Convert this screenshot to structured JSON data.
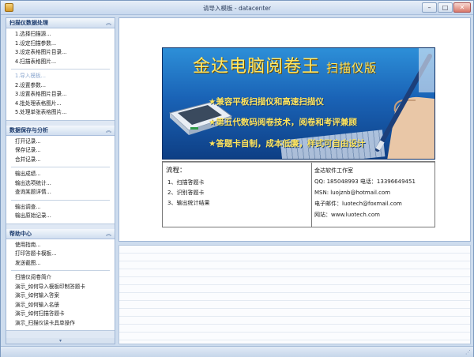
{
  "window": {
    "title": "请导入模板 - datacenter",
    "buttons": {
      "minimize": "–",
      "maximize": "□",
      "close": "✕"
    }
  },
  "sidebar": {
    "groups": [
      {
        "title": "扫描仪数据处理",
        "chevron": "︽",
        "sections": [
          [
            "1.选择扫描源...",
            "1.设定扫描参数...",
            "3.设定表格图片目录...",
            "4.扫描表格图片..."
          ],
          [
            "1.导入模板...",
            "2.设置参数...",
            "3.设置表格图片目录...",
            "4.批处理表格图片...",
            "5.处理单张表格图片..."
          ]
        ],
        "hover_item": "1.导入模板..."
      },
      {
        "title": "数据保存与分析",
        "chevron": "︽",
        "sections": [
          [
            "打开记录...",
            "保存记录...",
            "合并记录..."
          ],
          [
            "输出成绩...",
            "输出选项统计...",
            "查询某题详情..."
          ],
          [
            "输出调查...",
            "输出原始记录..."
          ]
        ]
      },
      {
        "title": "帮助中心",
        "chevron": "︽",
        "sections": [
          [
            "使用指南...",
            "打印答题卡模板...",
            "发送截图..."
          ],
          [
            "扫描仪阅卷简介",
            "演示_如何导入模板印制答题卡",
            "演示_如何输入答案",
            "演示_如何输入名册",
            "演示_如何扫描答题卡",
            "演示_扫描仪读卡具单操作"
          ]
        ]
      }
    ],
    "scroll_glyph": "▾"
  },
  "banner": {
    "title_main": "金达电脑阅卷王",
    "title_suffix": "扫描仪版",
    "bullets": [
      "★兼容平板扫描仪和高速扫描仪",
      "★第五代数码阅卷技术，阅卷和考评兼顾",
      "★答题卡自制，成本低廉，样式可自由设计"
    ]
  },
  "info": {
    "flow_title": "流程：",
    "flow_steps": [
      "1、扫描答题卡",
      "2、识别答题卡",
      "3、输出统计结果"
    ],
    "contacts": [
      "金达软件工作室",
      "QQ: 185048993 电话：13396649451",
      "MSN: luojznb@hotmail.com",
      "电子邮件：luotech@foxmail.com",
      "网站：www.luotech.com"
    ]
  },
  "status": {
    "grip": "⋰"
  },
  "colors": {
    "accent": "#1a63b6",
    "banner_text": "#ffe867",
    "frame": "#cddcee"
  }
}
